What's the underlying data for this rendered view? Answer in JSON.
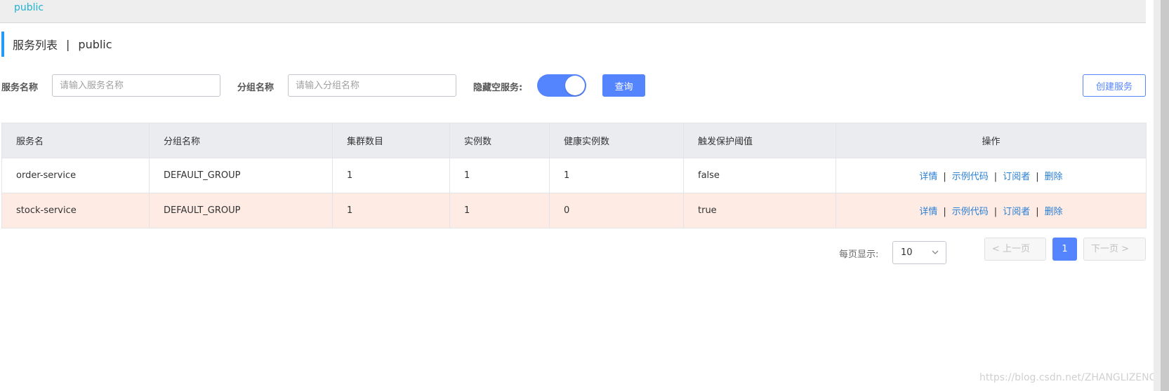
{
  "namespace_bar": {
    "active": "public"
  },
  "title": {
    "main": "服务列表",
    "separator": "|",
    "namespace": "public"
  },
  "filters": {
    "service_name_label": "服务名称",
    "service_name_placeholder": "请输入服务名称",
    "group_name_label": "分组名称",
    "group_name_placeholder": "请输入分组名称",
    "hide_empty_label": "隐藏空服务:",
    "hide_empty_on": true,
    "query_button": "查询",
    "create_button": "创建服务"
  },
  "table": {
    "columns": [
      "服务名",
      "分组名称",
      "集群数目",
      "实例数",
      "健康实例数",
      "触发保护阈值",
      "操作"
    ],
    "rows": [
      {
        "name": "order-service",
        "group": "DEFAULT_GROUP",
        "clusters": "1",
        "instances": "1",
        "healthy": "1",
        "protect": "false"
      },
      {
        "name": "stock-service",
        "group": "DEFAULT_GROUP",
        "clusters": "1",
        "instances": "1",
        "healthy": "0",
        "protect": "true"
      }
    ],
    "actions": {
      "detail": "详情",
      "sample": "示例代码",
      "subscriber": "订阅者",
      "delete": "删除",
      "divider": "|"
    }
  },
  "pagination": {
    "page_size_label": "每页显示:",
    "page_size": "10",
    "prev": "< 上一页",
    "current": "1",
    "next": "下一页 >"
  },
  "watermark": "https://blog.csdn.net/ZHANGLIZENG",
  "colors": {
    "primary": "#5584ff",
    "link": "#2a7fd4",
    "warn_row": "#fdebe4",
    "accent": "#209bfa"
  }
}
